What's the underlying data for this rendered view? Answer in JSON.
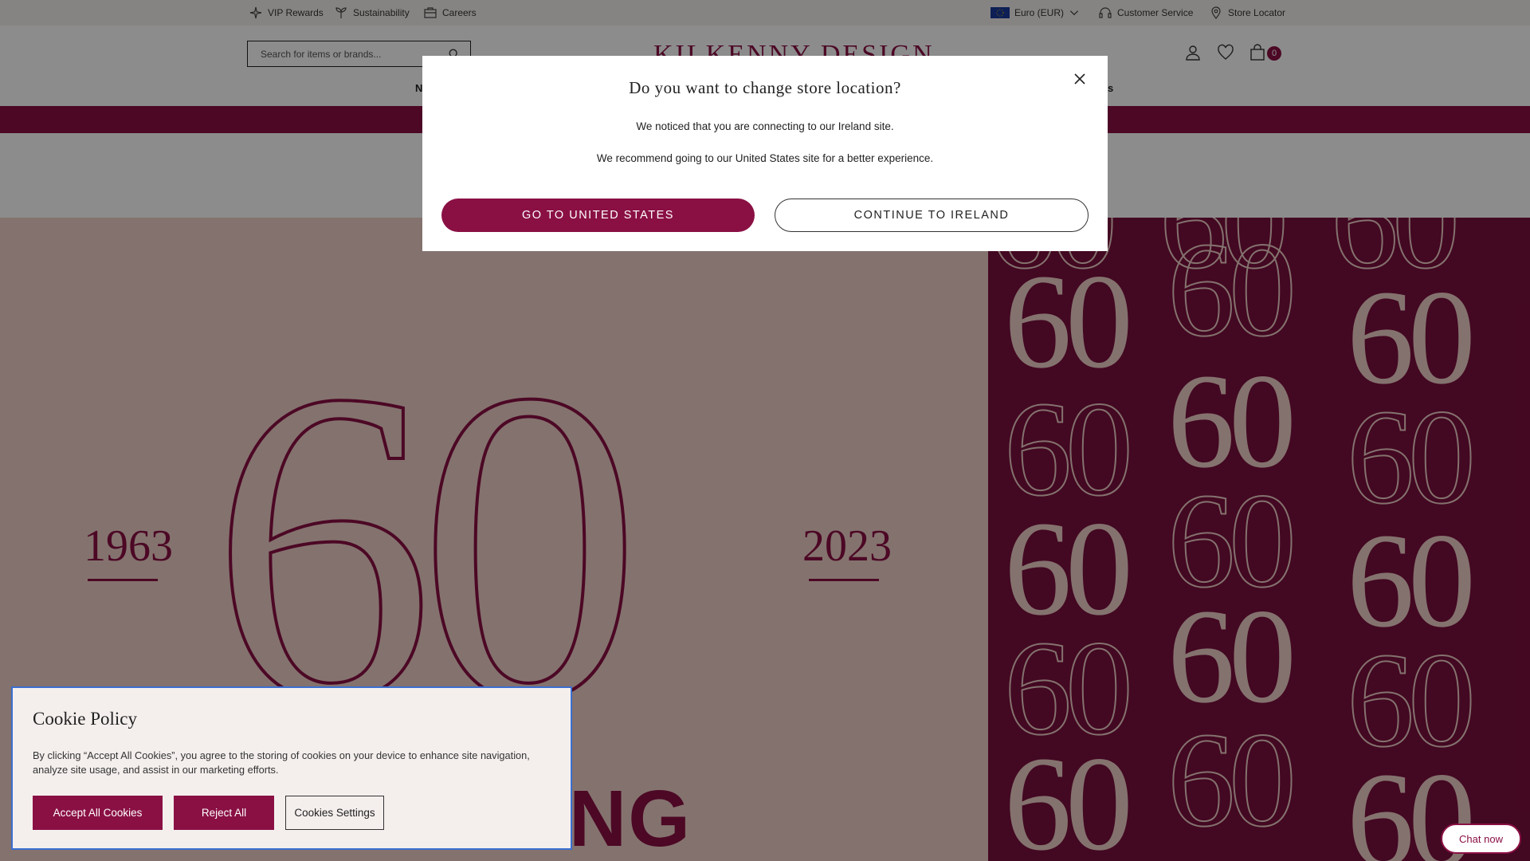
{
  "topbar": {
    "vip": "VIP Rewards",
    "sustainability": "Sustainability",
    "careers": "Careers",
    "currency": "Euro (EUR)",
    "customer_service": "Customer Service",
    "store_locator": "Store Locator"
  },
  "header": {
    "search_placeholder": "Search for items or brands...",
    "logo": "KILKENNY DESIGN",
    "cart_count": "0",
    "nav_fragment_left": "N",
    "nav_fragment_right": "s"
  },
  "hero": {
    "year_start": "1963",
    "year_end": "2023",
    "big_number": "60",
    "young_text": "OUNG",
    "tile_text": "60"
  },
  "modal": {
    "title": "Do you want to change store location?",
    "line1": "We noticed that you are connecting to our Ireland site.",
    "line2": "We recommend going to our United States site for a better experience.",
    "primary_button": "GO TO UNITED STATES",
    "secondary_button": "CONTINUE TO IRELAND"
  },
  "cookie": {
    "title": "Cookie Policy",
    "text": "By clicking “Accept All Cookies”, you agree to the storing of cookies on your device to enhance site navigation, analyze site usage, and assist in our marketing efforts.",
    "accept": "Accept All Cookies",
    "reject": "Reject All",
    "settings": "Cookies Settings"
  },
  "chat": {
    "label": "Chat now"
  },
  "colors": {
    "brand": "#8a1044",
    "hero_pink": "#f1cfc8",
    "cookie_bg": "#f4efed"
  }
}
